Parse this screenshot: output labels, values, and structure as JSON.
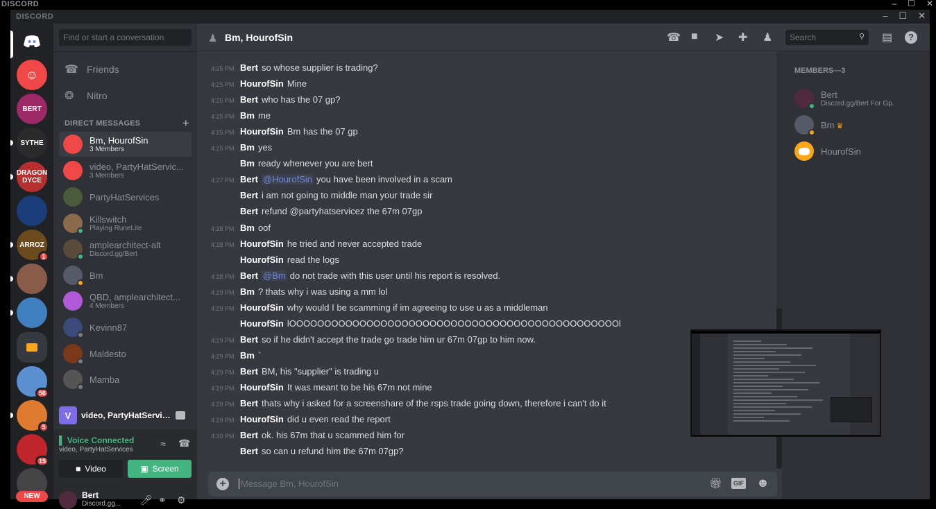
{
  "outer": {
    "logo": "DISCORD",
    "controls": [
      "–",
      "☐",
      "✕"
    ]
  },
  "window": {
    "logo": "DISCORD",
    "controls": [
      "–",
      "☐",
      "✕"
    ]
  },
  "guilds": [
    {
      "label": "",
      "color": "#7289da",
      "icon": "discord-logo-icon"
    },
    {
      "label": "",
      "color": "#f04747",
      "icon": "friends-icon"
    },
    {
      "label": "BERT",
      "color": "#9c2a66"
    },
    {
      "label": "SYTHE",
      "color": "#2b2b2b"
    },
    {
      "label": "DRAGON DYCE",
      "color": "#b72f2f"
    },
    {
      "label": "",
      "color": "#1b3e7a"
    },
    {
      "label": "ARROZ",
      "color": "#6b4a1e",
      "badge": "1"
    },
    {
      "label": "",
      "color": "#8a5a4a"
    },
    {
      "label": "",
      "color": "#3f7fbf"
    },
    {
      "label": "",
      "color": "#36393f",
      "icon": "folder-icon"
    },
    {
      "label": "",
      "color": "#5b8fd1",
      "badge": "56"
    },
    {
      "label": "",
      "color": "#e07a2f",
      "badge": "5"
    },
    {
      "label": "",
      "color": "#c0262c",
      "badge": "15"
    },
    {
      "label": "",
      "color": "#444",
      "new": "NEW"
    }
  ],
  "sidebar": {
    "search_placeholder": "Find or start a conversation",
    "friends": "Friends",
    "nitro": "Nitro",
    "dm_header": "DIRECT MESSAGES",
    "dm_add": "+",
    "dms": [
      {
        "name": "Bm, HourofSin",
        "sub": "3 Members",
        "color": "#f04747",
        "active": true
      },
      {
        "name": "video, PartyHatServic...",
        "sub": "3 Members",
        "color": "#f04747"
      },
      {
        "name": "PartyHatServices",
        "sub": "",
        "color": "#4a5a3a"
      },
      {
        "name": "Killswitch",
        "sub": "Playing RuneLite",
        "color": "#8a6a4a",
        "status": "#43b581"
      },
      {
        "name": "amplearchitect-alt",
        "sub": "Discord.gg/Bert",
        "color": "#5a4a3a",
        "status": "#43b581"
      },
      {
        "name": "Bm",
        "sub": "",
        "color": "#555a66",
        "status": "#faa61a"
      },
      {
        "name": "QBD, amplearchitect...",
        "sub": "4 Members",
        "color": "#b05ad8"
      },
      {
        "name": "Kevinn87",
        "sub": "",
        "color": "#3a4a7a",
        "status": "#747f8d"
      },
      {
        "name": "Maldesto",
        "sub": "",
        "color": "#7a3a1a",
        "status": "#747f8d"
      },
      {
        "name": "Mamba",
        "sub": "",
        "color": "#555",
        "status": "#747f8d"
      }
    ],
    "voice_channel": "video, PartyHatService...",
    "voice_channel_initial": "V",
    "voice_status": "Voice Connected",
    "voice_sub": "video, PartyHatServices",
    "video_label": "Video",
    "screen_label": "Screen",
    "user_name": "Bert",
    "user_sub": "Discord.gg..."
  },
  "header": {
    "title": "Bm, HourofSin",
    "search_placeholder": "Search"
  },
  "messages": [
    {
      "time": "4:25 PM",
      "author": "Bert",
      "content": "so whose supplier is trading?"
    },
    {
      "time": "4:25 PM",
      "author": "HourofSin",
      "content": "Mine"
    },
    {
      "time": "4:25 PM",
      "author": "Bert",
      "content": "who has the 07 gp?"
    },
    {
      "time": "4:25 PM",
      "author": "Bm",
      "content": "me"
    },
    {
      "time": "4:25 PM",
      "author": "HourofSin",
      "content": "Bm has the 07 gp"
    },
    {
      "time": "4:25 PM",
      "author": "Bm",
      "content": "yes"
    },
    {
      "time": "",
      "author": "Bm",
      "content": "ready whenever you are bert"
    },
    {
      "time": "4:27 PM",
      "author": "Bert",
      "mention": "@HourofSin",
      "content": "you have been involved in a scam"
    },
    {
      "time": "",
      "author": "Bert",
      "content": "i am not going to middle man your trade sir"
    },
    {
      "time": "",
      "author": "Bert",
      "content": "refund @partyhatservicez the 67m 07gp"
    },
    {
      "time": "4:28 PM",
      "author": "Bm",
      "content": "oof"
    },
    {
      "time": "4:28 PM",
      "author": "HourofSin",
      "content": "he tried and never accepted trade"
    },
    {
      "time": "",
      "author": "HourofSin",
      "content": "read the logs"
    },
    {
      "time": "4:28 PM",
      "author": "Bert",
      "mention": "@Bm",
      "content": "do not trade with this user until his report is resolved."
    },
    {
      "time": "4:29 PM",
      "author": "Bm",
      "content": "? thats why i was using a mm lol"
    },
    {
      "time": "4:29 PM",
      "author": "HourofSin",
      "content": "why would I be scamming if im agreeing to use u as a middleman"
    },
    {
      "time": "",
      "author": "HourofSin",
      "content": "lOOOOOOOOOOOOOOOOOOOOOOOOOOOOOOOOOOOOOOOOOOOOOOOl"
    },
    {
      "time": "4:29 PM",
      "author": "Bert",
      "content": "so if he didn't accept the trade go trade him ur 67m 07gp to him now."
    },
    {
      "time": "4:29 PM",
      "author": "Bm",
      "content": "`"
    },
    {
      "time": "4:29 PM",
      "author": "Bert",
      "content": "BM, his \"supplier\" is trading u"
    },
    {
      "time": "4:29 PM",
      "author": "HourofSin",
      "content": "It was meant to be his 67m not mine"
    },
    {
      "time": "4:29 PM",
      "author": "Bert",
      "content": "thats why i asked for a screenshare of the rsps trade going down, therefore i can't do it"
    },
    {
      "time": "4:29 PM",
      "author": "HourofSin",
      "content": "did u even read the report"
    },
    {
      "time": "4:30 PM",
      "author": "Bert",
      "content": "ok. his 67m that u scammed him for"
    },
    {
      "time": "",
      "author": "Bert",
      "content": "so can u refund him the 67m 07gp?"
    }
  ],
  "composer": {
    "placeholder": "Message Bm, HourofSin",
    "gif": "GIF"
  },
  "members": {
    "header": "MEMBERS—3",
    "list": [
      {
        "name": "Bert",
        "sub": "Discord.gg/Bert For Gp.",
        "color": "#4f2b3d",
        "status": "#43b581"
      },
      {
        "name": "Bm",
        "sub": "",
        "color": "#555a66",
        "status": "#faa61a",
        "owner": true
      },
      {
        "name": "HourofSin",
        "sub": "",
        "color": "#faa61a"
      }
    ]
  }
}
